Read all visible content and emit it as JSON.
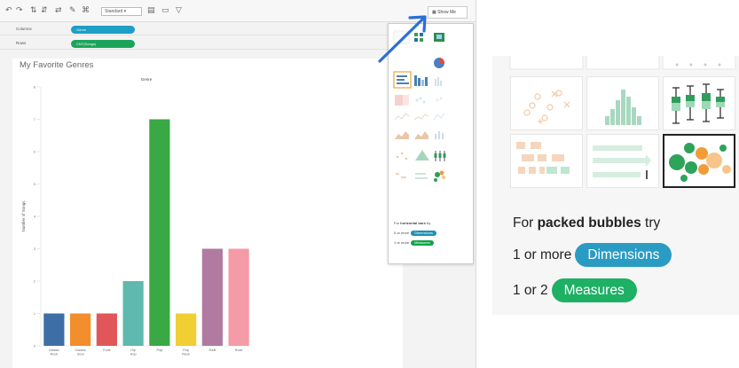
{
  "toolbar": {
    "dropdown_label": "Standard",
    "show_me_label": "Show Me"
  },
  "shelves": {
    "columns": {
      "label": "Columns",
      "pill": "Genre"
    },
    "rows": {
      "label": "Rows",
      "pill": "CNT(Songs)"
    }
  },
  "sheet_title": "My Favorite Genres",
  "chart_data": {
    "type": "bar",
    "title": "Genre",
    "xlabel": "",
    "ylabel": "Number of Songs",
    "ylim": [
      0,
      8
    ],
    "yticks": [
      0,
      1,
      2,
      3,
      4,
      5,
      6,
      7,
      8
    ],
    "categories": [
      "Classic Rock",
      "Classic Soul",
      "Funk",
      "Hip Hop",
      "Pop",
      "Pop Rock",
      "R&B",
      "Rock"
    ],
    "values": [
      1,
      1,
      1,
      2,
      7,
      1,
      3,
      3
    ],
    "colors": [
      "#3d6fa6",
      "#f28e2b",
      "#e15759",
      "#5fb9ae",
      "#3aa844",
      "#f1ce33",
      "#b07aa1",
      "#f59aa7"
    ],
    "grid": false,
    "legend": "none"
  },
  "show_me_panel": {
    "hint_prefix": "For",
    "hint_bold": "horizontal bars",
    "hint_suffix": "try",
    "dims_prefix": "0 or more",
    "dims_chip": "Dimensions",
    "meas_prefix": "1 or more",
    "meas_chip": "Measures",
    "colors": {
      "dimension": "#1d8fb3",
      "measure": "#15a34a"
    }
  },
  "inset": {
    "hint_prefix": "For",
    "hint_bold": "packed bubbles",
    "hint_suffix": "try",
    "dims_prefix": "1 or more",
    "dims_chip": "Dimensions",
    "meas_prefix": "1 or 2",
    "meas_chip": "Measures",
    "icons": [
      "scatter-plot-icon",
      "histogram-icon",
      "box-whisker-icon",
      "gantt-chart-icon",
      "bullet-graph-icon",
      "packed-bubbles-icon"
    ],
    "selected_icon": "packed-bubbles-icon",
    "colors": {
      "dimension": "#2a9cc4",
      "measure": "#1eb064",
      "selected_border": "#222222"
    }
  },
  "arrow": {
    "color": "#2a6fd6"
  }
}
